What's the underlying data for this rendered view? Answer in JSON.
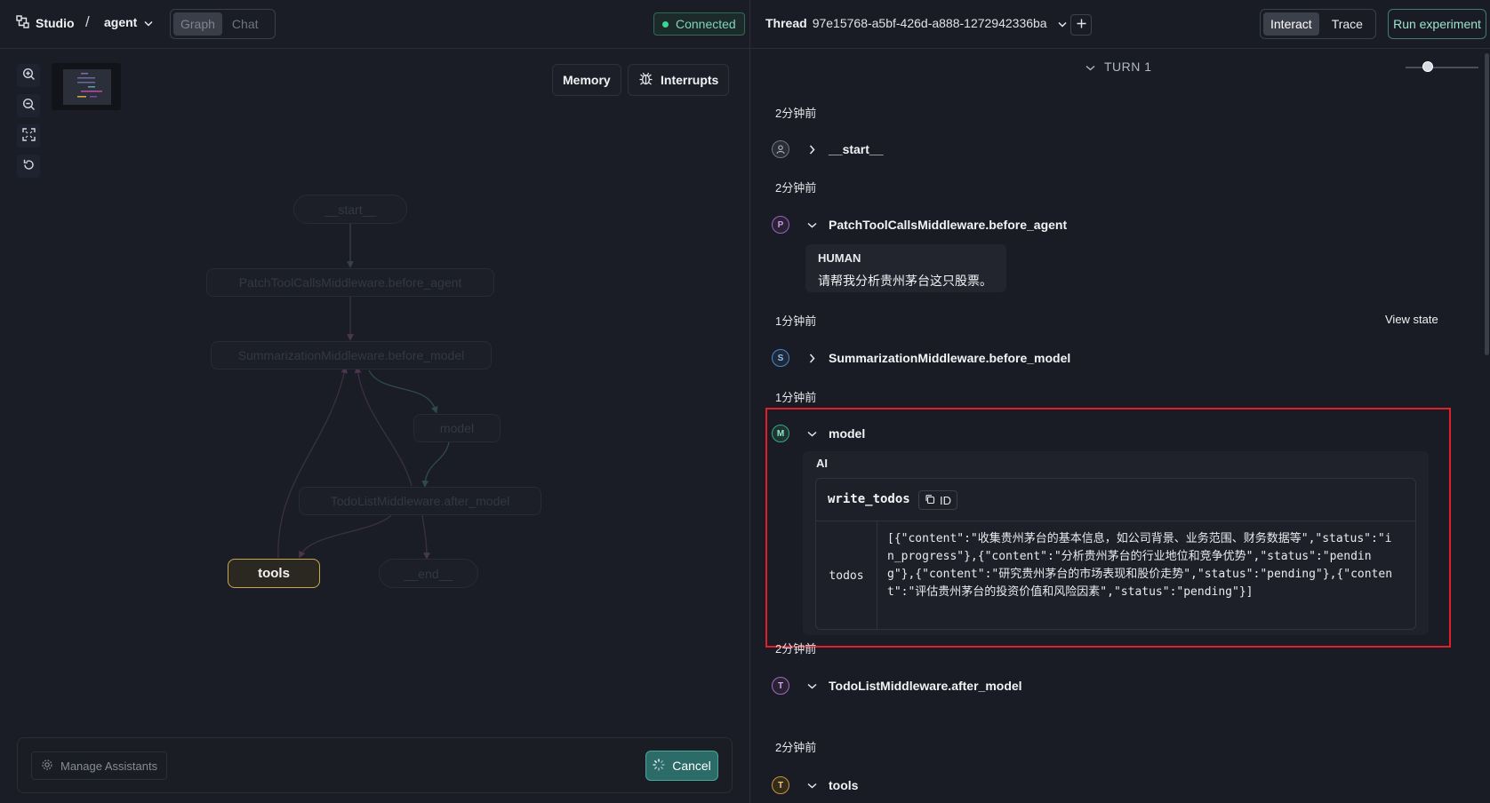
{
  "header": {
    "app_name": "Studio",
    "separator": "/",
    "assistant": "agent",
    "view_tabs": [
      "Graph",
      "Chat"
    ],
    "active_view": "Graph",
    "connection_status": "Connected"
  },
  "graph_toolbar": {
    "buttons": [
      "zoom-in-icon",
      "zoom-out-icon",
      "fit-view-icon",
      "reset-icon"
    ],
    "memory_label": "Memory",
    "interrupts_label": "Interrupts"
  },
  "graph": {
    "nodes": [
      {
        "id": "start",
        "label": "__start__"
      },
      {
        "id": "patch",
        "label": "PatchToolCallsMiddleware.before_agent"
      },
      {
        "id": "summ",
        "label": "SummarizationMiddleware.before_model"
      },
      {
        "id": "model",
        "label": "model"
      },
      {
        "id": "todo",
        "label": "TodoListMiddleware.after_model"
      },
      {
        "id": "tools",
        "label": "tools",
        "active": true
      },
      {
        "id": "end",
        "label": "__end__"
      }
    ]
  },
  "bottom_bar": {
    "manage_label": "Manage Assistants",
    "cancel_label": "Cancel"
  },
  "thread": {
    "label": "Thread",
    "id": "97e15768-a5bf-426d-a888-1272942336ba",
    "modes": [
      "Interact",
      "Trace"
    ],
    "active_mode": "Interact",
    "run_label": "Run experiment"
  },
  "turn": {
    "label": "TURN 1",
    "view_state_label": "View state",
    "steps": [
      {
        "time": "2分钟前",
        "badge": "",
        "badge_color": "#9aa0ab",
        "name": "__start__",
        "expanded": false
      },
      {
        "time": "2分钟前",
        "badge": "P",
        "badge_color": "#b07ad9",
        "name": "PatchToolCallsMiddleware.before_agent",
        "expanded": true,
        "message": {
          "role": "HUMAN",
          "text": "请帮我分析贵州茅台这只股票。"
        }
      },
      {
        "time": "1分钟前",
        "badge": "S",
        "badge_color": "#5a9ae0",
        "name": "SummarizationMiddleware.before_model",
        "expanded": false
      },
      {
        "time": "1分钟前",
        "badge": "M",
        "badge_color": "#4fc4a0",
        "name": "model",
        "expanded": true,
        "message": {
          "role": "AI",
          "tool_call": {
            "name": "write_todos",
            "id_label": "ID",
            "arg_key": "todos",
            "arg_value": "[{\"content\":\"收集贵州茅台的基本信息，如公司背景、业务范围、财务数据等\",\"status\":\"in_progress\"},{\"content\":\"分析贵州茅台的行业地位和竞争优势\",\"status\":\"pending\"},{\"content\":\"研究贵州茅台的市场表现和股价走势\",\"status\":\"pending\"},{\"content\":\"评估贵州茅台的投资价值和风险因素\",\"status\":\"pending\"}]"
          }
        }
      },
      {
        "time": "2分钟前",
        "badge": "T",
        "badge_color": "#c28ad9",
        "name": "TodoListMiddleware.after_model",
        "expanded": true
      },
      {
        "time": "2分钟前",
        "badge": "T",
        "badge_color": "#d4a84a",
        "name": "tools",
        "expanded": true
      }
    ]
  }
}
